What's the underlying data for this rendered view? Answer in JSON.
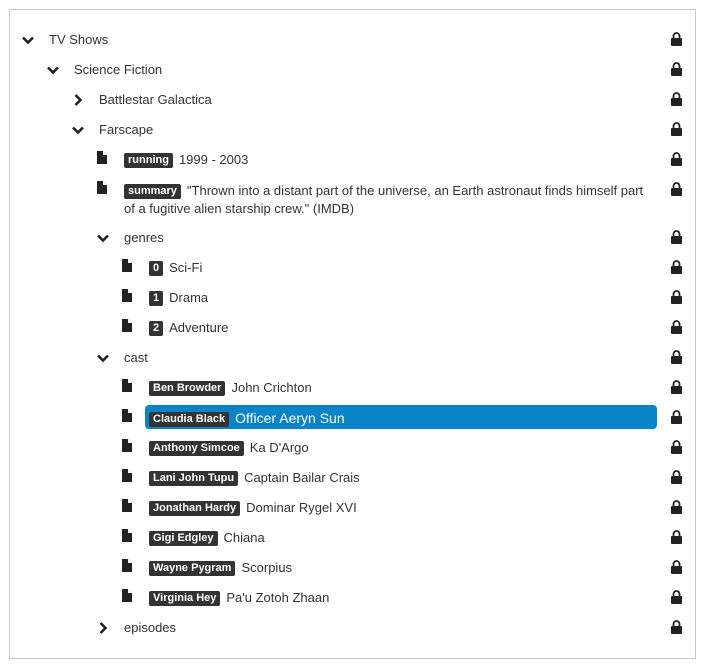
{
  "tree": {
    "root": {
      "label": "TV Shows"
    },
    "sci_fi": {
      "label": "Science Fiction"
    },
    "battlestar": {
      "label": "Battlestar Galactica"
    },
    "farscape": {
      "label": "Farscape"
    },
    "running": {
      "key": "running",
      "value": "1999 - 2003"
    },
    "summary": {
      "key": "summary",
      "value": "\"Thrown into a distant part of the universe, an Earth astronaut finds himself part of a fugitive alien starship crew.\" (IMDB)"
    },
    "genres": {
      "label": "genres",
      "items": [
        {
          "key": "0",
          "value": "Sci-Fi"
        },
        {
          "key": "1",
          "value": "Drama"
        },
        {
          "key": "2",
          "value": "Adventure"
        }
      ]
    },
    "cast": {
      "label": "cast",
      "items": [
        {
          "key": "Ben Browder",
          "value": "John Crichton"
        },
        {
          "key": "Claudia Black",
          "value": "Officer Aeryn Sun"
        },
        {
          "key": "Anthony Simcoe",
          "value": "Ka D'Argo"
        },
        {
          "key": "Lani John Tupu",
          "value": "Captain Bailar Crais"
        },
        {
          "key": "Jonathan Hardy",
          "value": "Dominar Rygel XVI"
        },
        {
          "key": "Gigi Edgley",
          "value": "Chiana"
        },
        {
          "key": "Wayne Pygram",
          "value": "Scorpius"
        },
        {
          "key": "Virginia Hey",
          "value": "Pa'u Zotoh Zhaan"
        }
      ]
    },
    "episodes": {
      "label": "episodes"
    }
  },
  "selected_item": "cast.items.1",
  "colors": {
    "selection": "#0a84c6",
    "badge": "#333333",
    "text": "#333333"
  },
  "icons": {
    "expanded": "chevron-down-icon",
    "collapsed": "chevron-right-icon",
    "leaf": "document-icon",
    "permission": "lock-icon"
  }
}
